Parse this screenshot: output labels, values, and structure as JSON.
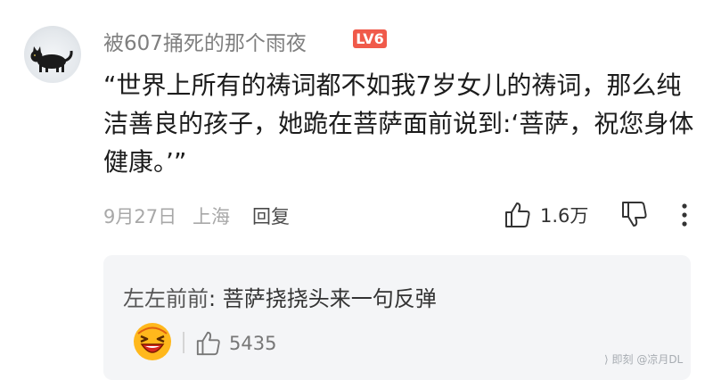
{
  "comment": {
    "username": "被607捅死的那个雨夜",
    "level_badge": "LV6",
    "text": "“世界上所有的祷词都不如我7岁女儿的祷词，那么纯洁善良的孩子，她跪在菩萨面前说到:‘菩萨，祝您身体健康。’”",
    "date": "9月27日",
    "location": "上海",
    "reply_label": "回复",
    "like_count": "1.6万"
  },
  "reply": {
    "author": "左左前前",
    "separator": ":",
    "text": " 菩萨挠挠头来一句反弹",
    "like_count": "5435"
  },
  "watermark": "@凉月DL",
  "icons": {
    "avatar": "black-cat-in-snow-avatar",
    "like": "thumbs-up-icon",
    "dislike": "thumbs-down-icon",
    "more": "more-vertical-icon",
    "reply_avatar": "laughing-emoji-avatar"
  },
  "colors": {
    "level_badge": "#f05a4a",
    "reply_background": "#f4f5f7"
  }
}
